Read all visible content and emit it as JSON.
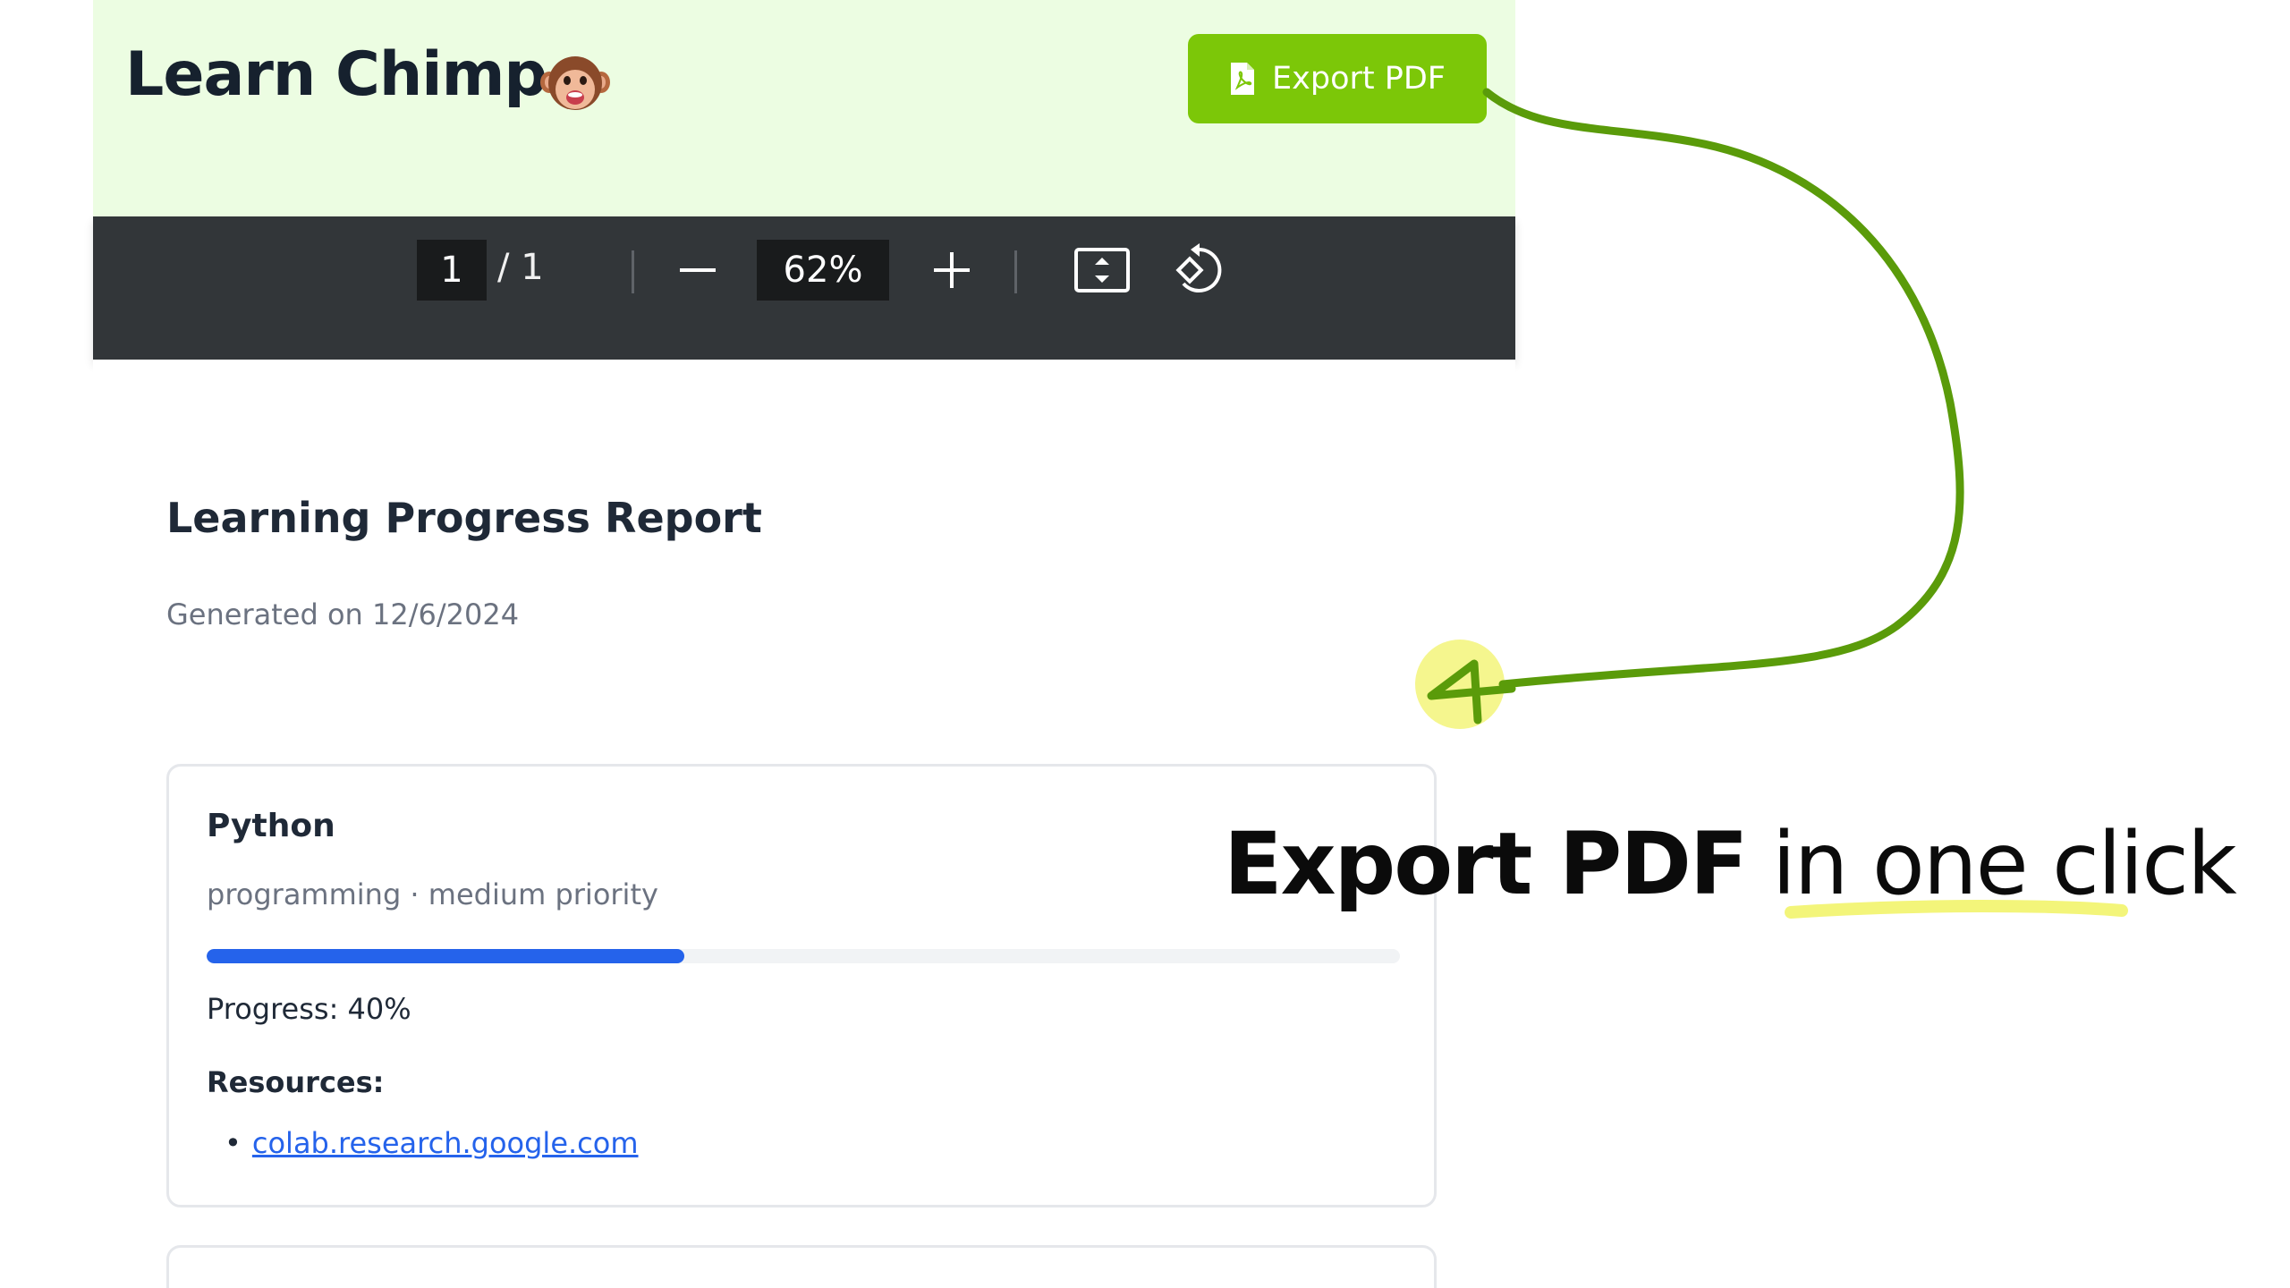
{
  "app": {
    "title": "Learn Chimp",
    "export_button_label": "Export PDF"
  },
  "toolbar": {
    "current_page": "1",
    "page_separator": "/ 1",
    "zoom": "62%"
  },
  "report": {
    "title": "Learning Progress Report",
    "generated": "Generated on 12/6/2024",
    "items": [
      {
        "name": "Python",
        "meta": "programming · medium priority",
        "progress": 0.4,
        "progress_text": "Progress: 40%",
        "resources_label": "Resources:",
        "resources": [
          "colab.research.google.com"
        ]
      }
    ]
  },
  "callout": {
    "bold": "Export PDF",
    "light_prefix": "in",
    "light_underlined": "one click"
  },
  "colors": {
    "header_bg": "#ecfde2",
    "export_button": "#7cc708",
    "toolbar_bg": "#323639",
    "progress_fill": "#2563eb",
    "arrow": "#5a9b0a",
    "highlight": "#f3f57a"
  }
}
